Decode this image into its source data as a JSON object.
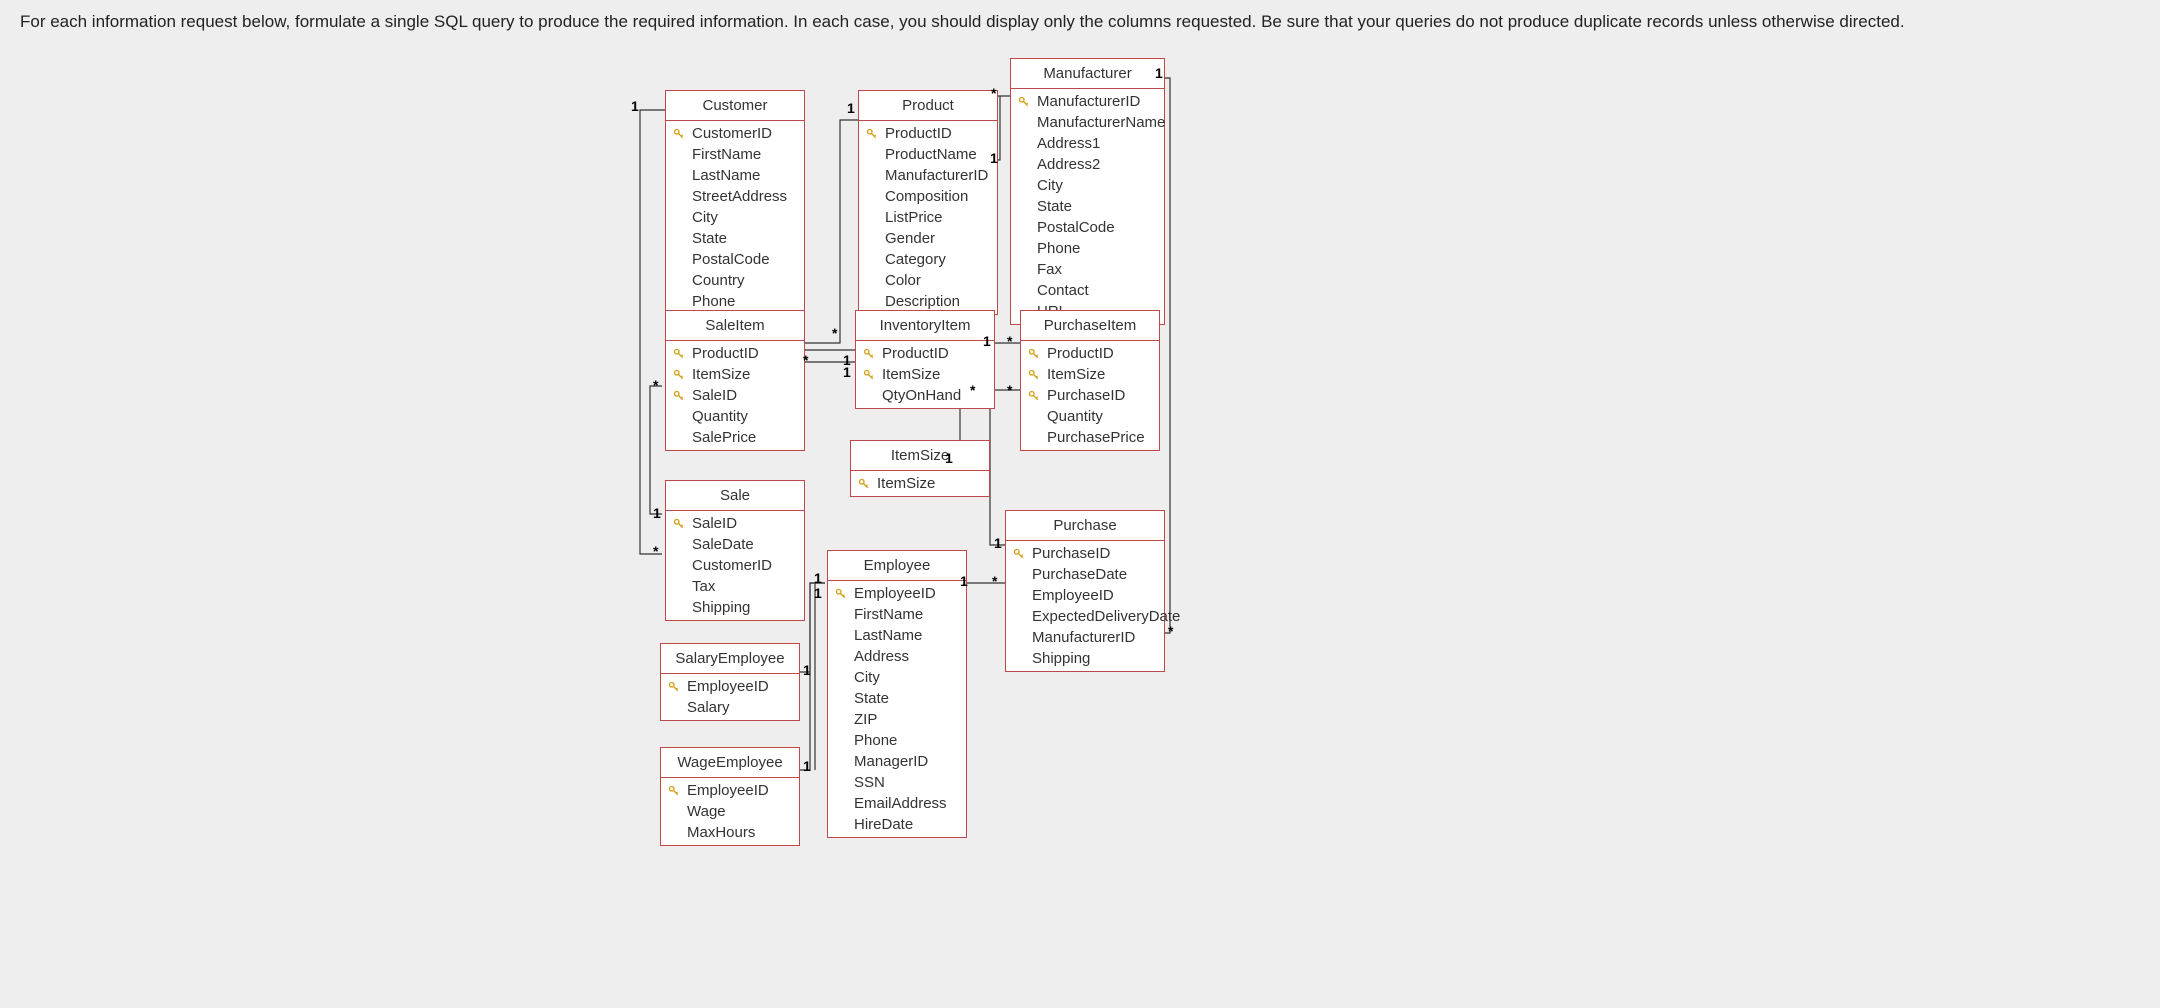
{
  "instruction": "For each information request below, formulate a single SQL query to produce the required information.  In each case, you should display only the columns requested.  Be sure that your queries do not produce duplicate records unless otherwise directed.",
  "entities": {
    "customer": {
      "title": "Customer",
      "fields": [
        {
          "name": "CustomerID",
          "pk": true
        },
        {
          "name": "FirstName"
        },
        {
          "name": "LastName"
        },
        {
          "name": "StreetAddress"
        },
        {
          "name": "City"
        },
        {
          "name": "State"
        },
        {
          "name": "PostalCode"
        },
        {
          "name": "Country"
        },
        {
          "name": "Phone"
        }
      ]
    },
    "product": {
      "title": "Product",
      "fields": [
        {
          "name": "ProductID",
          "pk": true
        },
        {
          "name": "ProductName"
        },
        {
          "name": "ManufacturerID"
        },
        {
          "name": "Composition"
        },
        {
          "name": "ListPrice"
        },
        {
          "name": "Gender"
        },
        {
          "name": "Category"
        },
        {
          "name": "Color"
        },
        {
          "name": "Description"
        }
      ]
    },
    "manufacturer": {
      "title": "Manufacturer",
      "fields": [
        {
          "name": "ManufacturerID",
          "pk": true
        },
        {
          "name": "ManufacturerName"
        },
        {
          "name": "Address1"
        },
        {
          "name": "Address2"
        },
        {
          "name": "City"
        },
        {
          "name": "State"
        },
        {
          "name": "PostalCode"
        },
        {
          "name": "Phone"
        },
        {
          "name": "Fax"
        },
        {
          "name": "Contact"
        },
        {
          "name": "URL"
        }
      ]
    },
    "saleitem": {
      "title": "SaleItem",
      "fields": [
        {
          "name": "ProductID",
          "pk": true
        },
        {
          "name": "ItemSize",
          "pk": true
        },
        {
          "name": "SaleID",
          "pk": true
        },
        {
          "name": "Quantity"
        },
        {
          "name": "SalePrice"
        }
      ]
    },
    "inventoryitem": {
      "title": "InventoryItem",
      "fields": [
        {
          "name": "ProductID",
          "pk": true
        },
        {
          "name": "ItemSize",
          "pk": true
        },
        {
          "name": "QtyOnHand"
        }
      ]
    },
    "purchaseitem": {
      "title": "PurchaseItem",
      "fields": [
        {
          "name": "ProductID",
          "pk": true
        },
        {
          "name": "ItemSize",
          "pk": true
        },
        {
          "name": "PurchaseID",
          "pk": true
        },
        {
          "name": "Quantity"
        },
        {
          "name": "PurchasePrice"
        }
      ]
    },
    "itemsize": {
      "title": "ItemSize",
      "fields": [
        {
          "name": "ItemSize",
          "pk": true
        }
      ]
    },
    "sale": {
      "title": "Sale",
      "fields": [
        {
          "name": "SaleID",
          "pk": true
        },
        {
          "name": "SaleDate"
        },
        {
          "name": "CustomerID"
        },
        {
          "name": "Tax"
        },
        {
          "name": "Shipping"
        }
      ]
    },
    "purchase": {
      "title": "Purchase",
      "fields": [
        {
          "name": "PurchaseID",
          "pk": true
        },
        {
          "name": "PurchaseDate"
        },
        {
          "name": "EmployeeID"
        },
        {
          "name": "ExpectedDeliveryDate"
        },
        {
          "name": "ManufacturerID"
        },
        {
          "name": "Shipping"
        }
      ]
    },
    "employee": {
      "title": "Employee",
      "fields": [
        {
          "name": "EmployeeID",
          "pk": true
        },
        {
          "name": "FirstName"
        },
        {
          "name": "LastName"
        },
        {
          "name": "Address"
        },
        {
          "name": "City"
        },
        {
          "name": "State"
        },
        {
          "name": "ZIP"
        },
        {
          "name": "Phone"
        },
        {
          "name": "ManagerID"
        },
        {
          "name": "SSN"
        },
        {
          "name": "EmailAddress"
        },
        {
          "name": "HireDate"
        }
      ]
    },
    "salaryemployee": {
      "title": "SalaryEmployee",
      "fields": [
        {
          "name": "EmployeeID",
          "pk": true
        },
        {
          "name": "Salary"
        }
      ]
    },
    "wageemployee": {
      "title": "WageEmployee",
      "fields": [
        {
          "name": "EmployeeID",
          "pk": true
        },
        {
          "name": "Wage"
        },
        {
          "name": "MaxHours"
        }
      ]
    }
  },
  "cardinalities": {
    "one": "1",
    "many": "*"
  }
}
